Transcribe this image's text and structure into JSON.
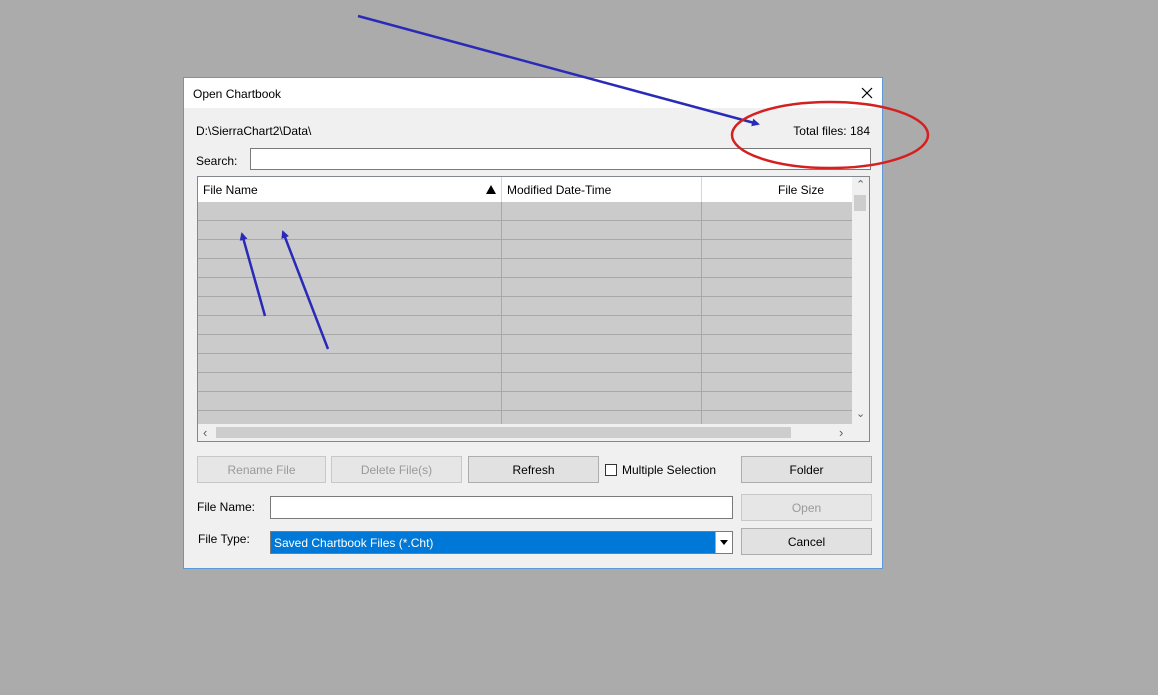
{
  "dialog": {
    "title": "Open Chartbook",
    "path": "D:\\SierraChart2\\Data\\",
    "total_files": "Total files: 184",
    "search_label": "Search:",
    "search_value": ""
  },
  "list": {
    "columns": [
      "File Name",
      "Modified Date-Time",
      "File Size"
    ],
    "sort_column": "File Name",
    "row_count_visible": 12
  },
  "buttons": {
    "rename": "Rename File",
    "delete": "Delete File(s)",
    "refresh": "Refresh",
    "folder": "Folder",
    "open": "Open",
    "cancel": "Cancel"
  },
  "multiple_selection": {
    "label": "Multiple Selection",
    "checked": false
  },
  "file_name": {
    "label": "File Name:",
    "value": ""
  },
  "file_type": {
    "label": "File Type:",
    "selected": "Saved Chartbook Files (*.Cht)"
  },
  "icons": {
    "close": "close-icon",
    "sort": "sort-ascending-icon",
    "dropdown": "chevron-down-icon"
  },
  "colors": {
    "annotation_arrow": "#2a2ab8",
    "annotation_circle": "#d42020",
    "selection": "#0078d7"
  }
}
